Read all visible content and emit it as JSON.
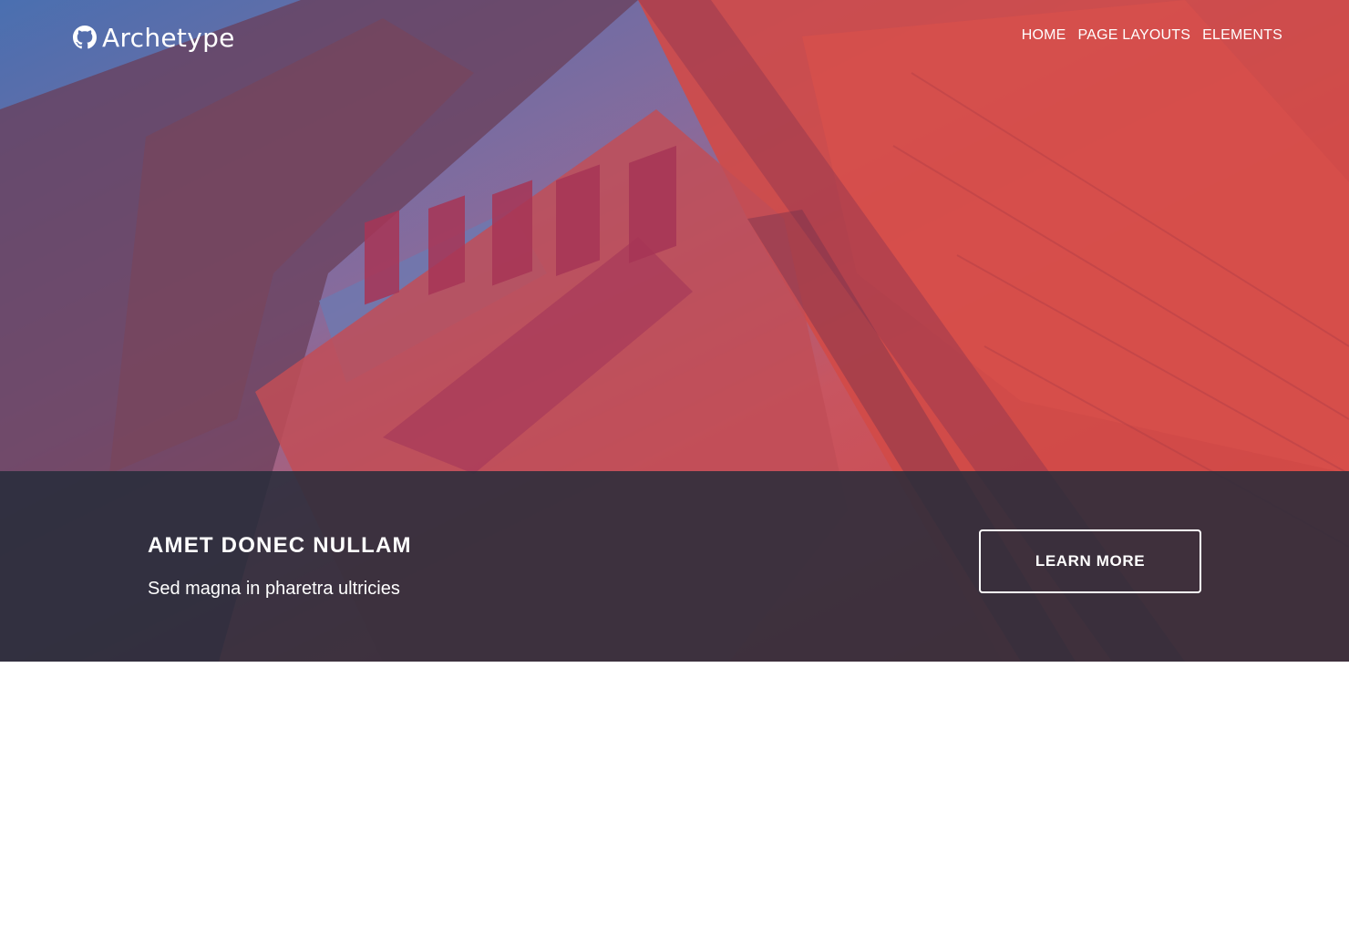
{
  "site": {
    "brand": "Archetype",
    "brand_icon": "github-icon"
  },
  "nav": {
    "items": [
      {
        "label": "HOME"
      },
      {
        "label": "PAGE LAYOUTS"
      },
      {
        "label": "ELEMENTS"
      }
    ]
  },
  "banner": {
    "title": "AMET DONEC NULLAM",
    "subtitle": "Sed magna in pharetra ultricies",
    "button_label": "LEARN MORE"
  },
  "colors": {
    "banner_overlay": "#262c3a",
    "text": "#ffffff",
    "hero_red": "#d6443f",
    "hero_blue": "#5a79b4"
  }
}
